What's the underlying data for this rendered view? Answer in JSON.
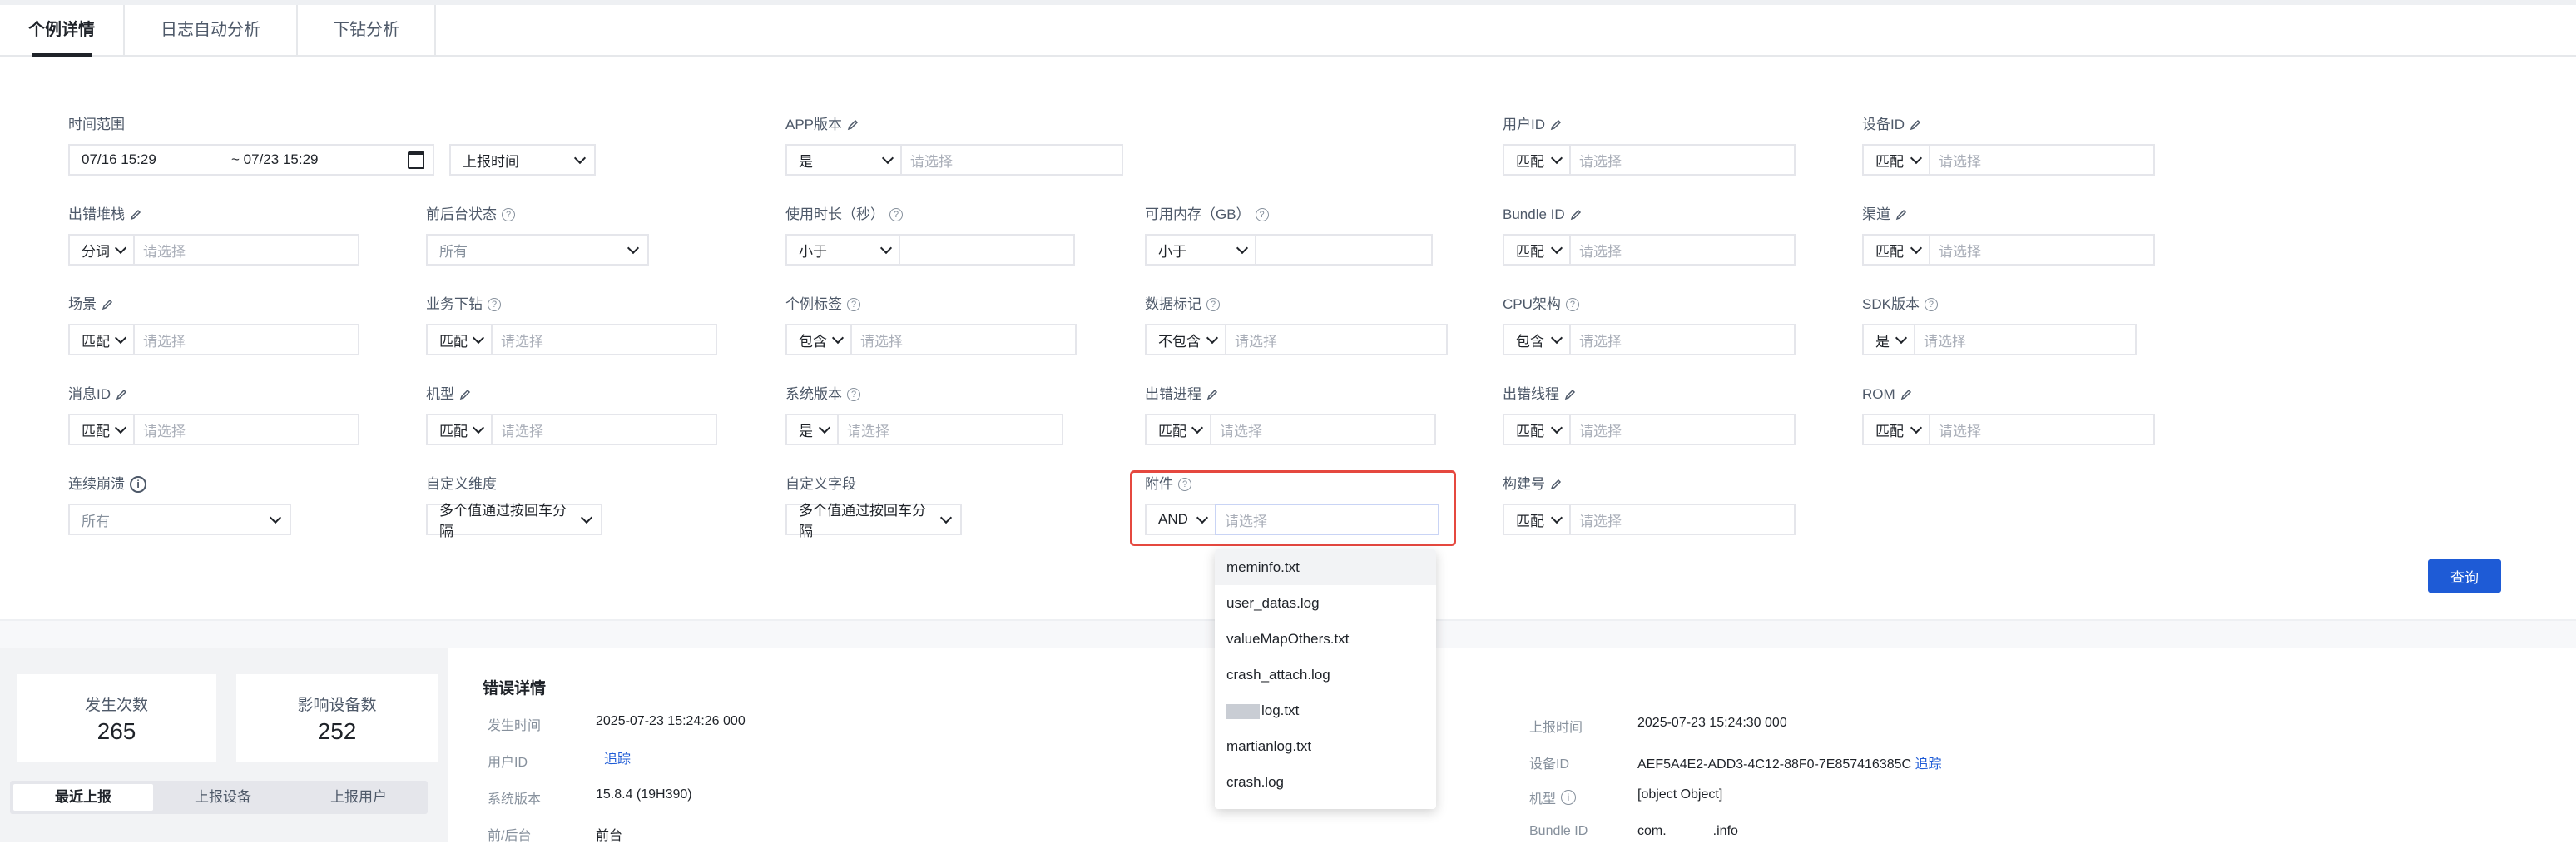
{
  "tabs": [
    "个例详情",
    "日志自动分析",
    "下钻分析"
  ],
  "placeholder": "请选择",
  "filters": {
    "time_range": {
      "label": "时间范围",
      "start": "07/16 15:29",
      "sep": "~",
      "end": "07/23 15:29",
      "type_select": "上报时间"
    },
    "app_version": {
      "label": "APP版本",
      "op": "是"
    },
    "user_id": {
      "label": "用户ID",
      "op": "匹配"
    },
    "device_id": {
      "label": "设备ID",
      "op": "匹配"
    },
    "stack": {
      "label": "出错堆栈",
      "op": "分词"
    },
    "fg_bg": {
      "label": "前后台状态",
      "value": "所有"
    },
    "duration": {
      "label": "使用时长（秒）",
      "op": "小于"
    },
    "memory": {
      "label": "可用内存（GB）",
      "op": "小于"
    },
    "bundle_id": {
      "label": "Bundle ID",
      "op": "匹配"
    },
    "channel": {
      "label": "渠道",
      "op": "匹配"
    },
    "scene": {
      "label": "场景",
      "op": "匹配"
    },
    "biz_drill": {
      "label": "业务下钻",
      "op": "匹配"
    },
    "case_tag": {
      "label": "个例标签",
      "op": "包含"
    },
    "data_mark": {
      "label": "数据标记",
      "op": "不包含"
    },
    "cpu_arch": {
      "label": "CPU架构",
      "op": "包含"
    },
    "sdk_version": {
      "label": "SDK版本",
      "op": "是"
    },
    "msg_id": {
      "label": "消息ID",
      "op": "匹配"
    },
    "model": {
      "label": "机型",
      "op": "匹配"
    },
    "os_version": {
      "label": "系统版本",
      "op": "是"
    },
    "process": {
      "label": "出错进程",
      "op": "匹配"
    },
    "thread": {
      "label": "出错线程",
      "op": "匹配"
    },
    "rom": {
      "label": "ROM",
      "op": "匹配"
    },
    "consecutive": {
      "label": "连续崩溃",
      "value": "所有"
    },
    "custom_dim": {
      "label": "自定义维度",
      "value": "多个值通过按回车分隔"
    },
    "custom_field": {
      "label": "自定义字段",
      "value": "多个值通过按回车分隔"
    },
    "attachment": {
      "label": "附件",
      "op": "AND"
    },
    "build_no": {
      "label": "构建号",
      "op": "匹配"
    }
  },
  "query_button": "查询",
  "attachment_dropdown": {
    "items": [
      "meminfo.txt",
      "user_datas.log",
      "valueMapOthers.txt",
      "crash_attach.log",
      "log.txt",
      "martianlog.txt",
      "crash.log"
    ]
  },
  "stats": {
    "occurrences": {
      "label": "发生次数",
      "value": "265"
    },
    "devices": {
      "label": "影响设备数",
      "value": "252"
    }
  },
  "segments": [
    "最近上报",
    "上报设备",
    "上报用户"
  ],
  "error_detail": {
    "title": "错误详情",
    "left": [
      {
        "key": "发生时间",
        "value": "2025-07-23 15:24:26 000"
      },
      {
        "key": "用户ID",
        "value": "",
        "link": "追踪"
      },
      {
        "key": "系统版本",
        "value": "15.8.4 (19H390)"
      },
      {
        "key": "前/后台",
        "value": "前台"
      }
    ],
    "right": [
      {
        "key": "上报时间",
        "value": "2025-07-23 15:24:30 000"
      },
      {
        "key": "设备ID",
        "value": "AEF5A4E2-ADD3-4C12-88F0-7E857416385C",
        "link": "追踪"
      },
      {
        "key": "机型",
        "value": "[object Object]"
      },
      {
        "key": "Bundle ID",
        "value": "com.",
        "value2": ".info"
      }
    ]
  }
}
